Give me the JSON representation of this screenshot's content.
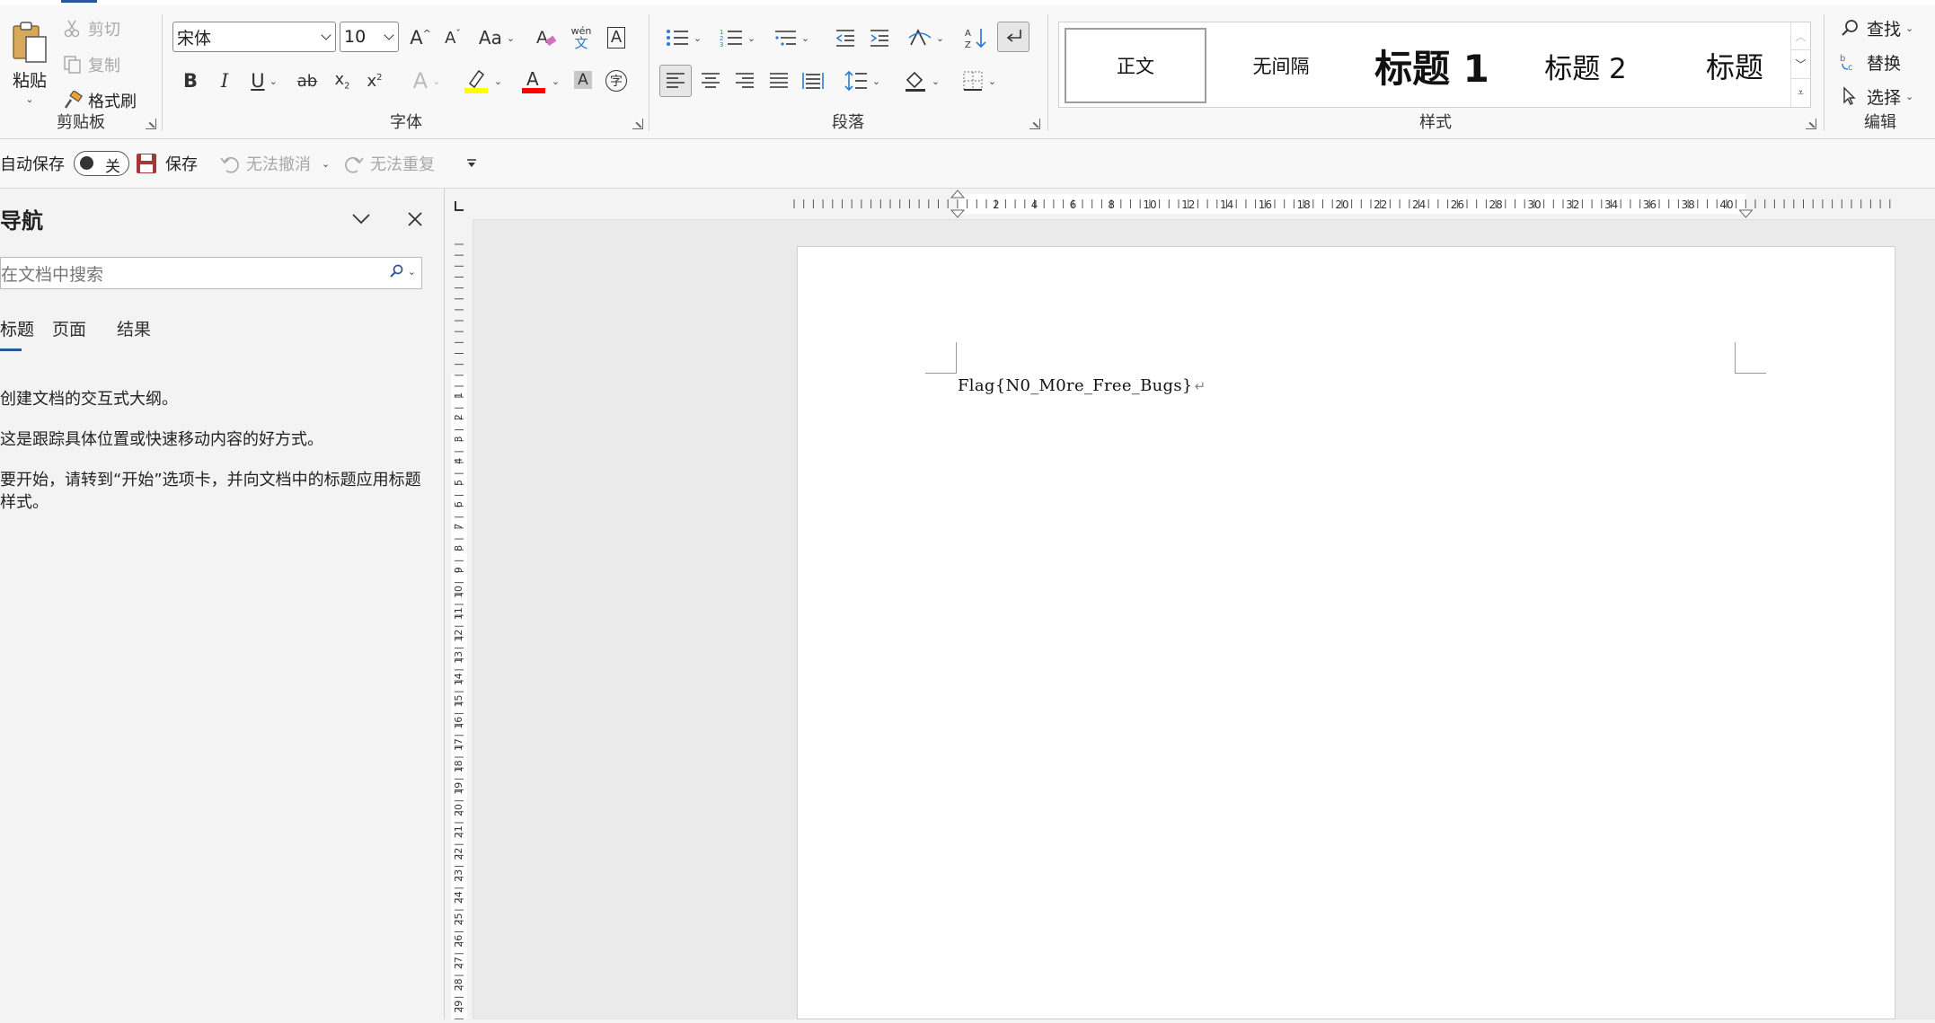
{
  "clipboard": {
    "group_label": "剪贴板",
    "paste_label": "粘贴",
    "cut_label": "剪切",
    "copy_label": "复制",
    "format_painter_label": "格式刷"
  },
  "font": {
    "group_label": "字体",
    "font_name": "宋体",
    "font_size": "10",
    "change_case_label": "Aa",
    "phonetic_label": "wén",
    "phonetic_char": "文",
    "highlight_color": "#ffff00",
    "font_color": "#ff0000"
  },
  "paragraph": {
    "group_label": "段落"
  },
  "styles": {
    "group_label": "样式",
    "items": [
      "正文",
      "无间隔",
      "标题 1",
      "标题 2",
      "标题"
    ]
  },
  "editing": {
    "group_label": "编辑",
    "find_label": "查找",
    "replace_label": "替换",
    "select_label": "选择"
  },
  "qat": {
    "autosave_label": "自动保存",
    "autosave_state": "关",
    "save_label": "保存",
    "undo_label": "无法撤消",
    "redo_label": "无法重复"
  },
  "nav": {
    "title": "导航",
    "search_placeholder": "在文档中搜索",
    "tabs": [
      "标题",
      "页面",
      "结果"
    ],
    "messages": [
      "创建文档的交互式大纲。",
      "这是跟踪具体位置或快速移动内容的好方式。",
      "要开始，请转到“开始”选项卡，并向文档中的标题应用标题样式。"
    ]
  },
  "ruler": {
    "h_labels": [
      "2",
      "4",
      "6",
      "8",
      "10",
      "12",
      "14",
      "16",
      "18",
      "20",
      "22",
      "24",
      "26",
      "28",
      "30",
      "32",
      "34",
      "36",
      "38",
      "40"
    ],
    "v_labels": [
      "1",
      "2",
      "3",
      "4",
      "5",
      "6",
      "7",
      "8",
      "9",
      "10",
      "11",
      "12",
      "13",
      "14",
      "15",
      "16",
      "17",
      "18",
      "19",
      "20",
      "21",
      "22",
      "23",
      "24",
      "25",
      "26",
      "27",
      "28",
      "29"
    ]
  },
  "document": {
    "text": "Flag{N0_M0re_Free_Bugs}",
    "paragraph_mark": "↵"
  },
  "colors": {
    "accent": "#2b579a",
    "save_icon": "#a4373a",
    "replace_icon": "#2b7cd3"
  }
}
